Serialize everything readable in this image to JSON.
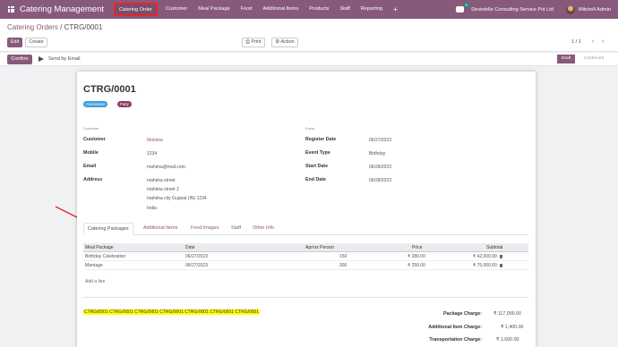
{
  "navbar": {
    "brand": "Catering Management",
    "menu": [
      "Catering Order",
      "Customer",
      "Meal Package",
      "Food",
      "Additional Items",
      "Products",
      "Staff",
      "Reporting",
      "+"
    ],
    "chat_badge": "9",
    "company": "Devintelle Consulting Service Pvt Ltd",
    "user": "Mitchell Admin",
    "accent": "#875a7b",
    "highlight_color": "#e5262c"
  },
  "control": {
    "breadcrumb_parent": "Catering Orders",
    "breadcrumb_sep": "/",
    "breadcrumb_current": "CTRG/0001",
    "edit": "Edit",
    "create": "Create",
    "print": "Print",
    "action": "Action",
    "pager": "1 / 1",
    "prev": "‹",
    "next": "›"
  },
  "statusbar": {
    "confirm": "Confirm",
    "send_email": "Send by Email",
    "stage_current": "Draft",
    "stage_next": "Confirmed"
  },
  "sheet": {
    "title": "CTRG/0001",
    "tags": [
      "Celebration",
      "Party"
    ],
    "customer_group": "Customer",
    "event_group": "Event",
    "customer": {
      "customer_label": "Customer",
      "customer_value": "Mahima",
      "mobile_label": "Mobile",
      "mobile_value": "1234",
      "email_label": "Email",
      "email_value": "mahima@mail.com",
      "address_label": "Address",
      "address_lines": [
        "mahima street",
        "mahima street 2",
        "mahima city  Gujarat (IN)  1234",
        "India"
      ]
    },
    "event": {
      "register_label": "Register Date",
      "register_value": "06/27/2023",
      "type_label": "Event Type",
      "type_value": "Birthday",
      "start_label": "Start Date",
      "start_value": "06/28/2023",
      "end_label": "End Date",
      "end_value": "06/28/2023"
    },
    "tabs": [
      "Catering Packages",
      "Additional Items",
      "Food Images",
      "Staff",
      "Other Info"
    ],
    "table": {
      "headers": [
        "Meal Package",
        "Date",
        "Aprrox Person",
        "Price",
        "Subtotal"
      ],
      "rows": [
        [
          "Birthday Celebration",
          "06/27/2023",
          "150",
          "₹ 280.00",
          "₹ 42,000.00"
        ],
        [
          "Marriage",
          "06/27/2023",
          "300",
          "₹ 250.00",
          "₹ 75,000.00"
        ]
      ],
      "add_line": "Add a line"
    },
    "notes": "CTRG/0001 CTRG/0001 CTRG/0001 CTRG/0001 CTRG/0001 CTRG/0001 CTRG/0001",
    "totals": [
      {
        "label": "Package Charge:",
        "value": "₹ 117,000.00"
      },
      {
        "label": "Additional Item Charge:",
        "value": "₹ 1,400.00"
      },
      {
        "label": "Transportation Charge:",
        "value": "₹ 1,500.00"
      }
    ]
  }
}
